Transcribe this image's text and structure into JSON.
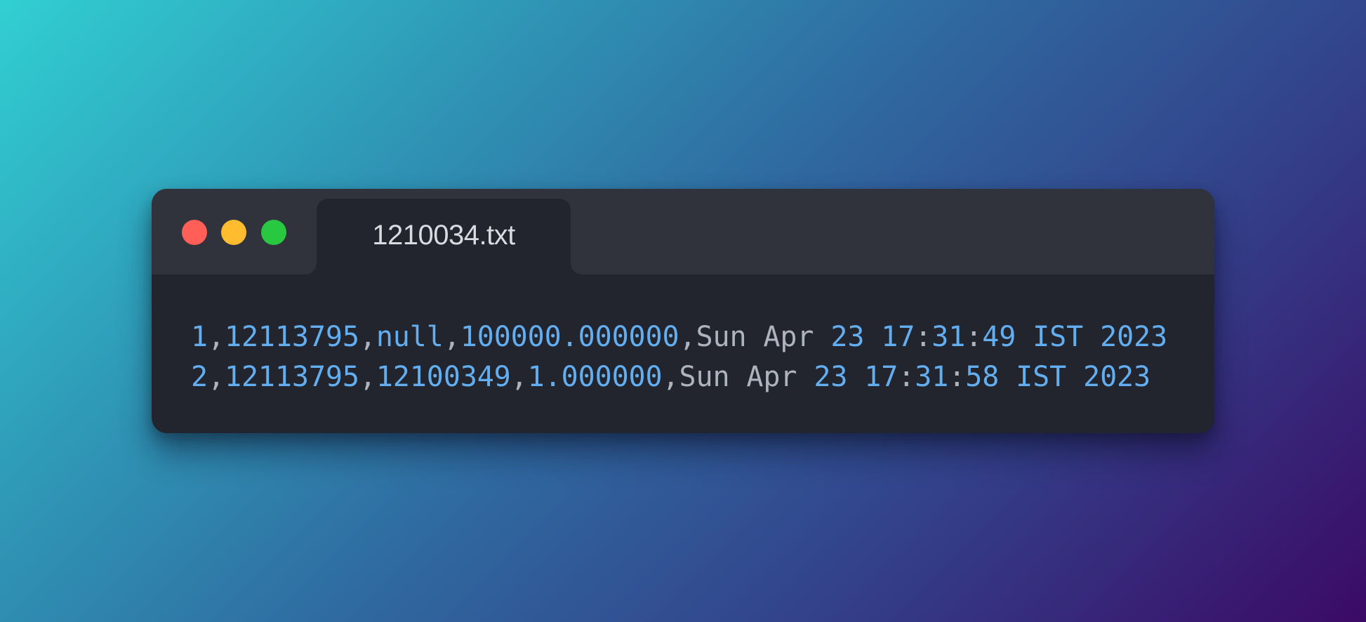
{
  "window": {
    "tab_title": "1210034.txt",
    "traffic_lights": [
      {
        "name": "close",
        "color": "#ff5f57"
      },
      {
        "name": "minimize",
        "color": "#febc2e"
      },
      {
        "name": "zoom",
        "color": "#28c840"
      }
    ]
  },
  "file": {
    "lines": [
      {
        "tokens": [
          {
            "text": "1",
            "kind": "number"
          },
          {
            "text": ",",
            "kind": "text"
          },
          {
            "text": "12113795",
            "kind": "number"
          },
          {
            "text": ",",
            "kind": "text"
          },
          {
            "text": "null",
            "kind": "number"
          },
          {
            "text": ",",
            "kind": "text"
          },
          {
            "text": "100000.000000",
            "kind": "number"
          },
          {
            "text": ",Sun Apr ",
            "kind": "text"
          },
          {
            "text": "23 17",
            "kind": "number"
          },
          {
            "text": ":",
            "kind": "text"
          },
          {
            "text": "31",
            "kind": "number"
          },
          {
            "text": ":",
            "kind": "text"
          },
          {
            "text": "49 IST 2023",
            "kind": "number"
          }
        ]
      },
      {
        "tokens": [
          {
            "text": "2",
            "kind": "number"
          },
          {
            "text": ",",
            "kind": "text"
          },
          {
            "text": "12113795",
            "kind": "number"
          },
          {
            "text": ",",
            "kind": "text"
          },
          {
            "text": "12100349",
            "kind": "number"
          },
          {
            "text": ",",
            "kind": "text"
          },
          {
            "text": "1.000000",
            "kind": "number"
          },
          {
            "text": ",Sun Apr ",
            "kind": "text"
          },
          {
            "text": "23 17",
            "kind": "number"
          },
          {
            "text": ":",
            "kind": "text"
          },
          {
            "text": "31",
            "kind": "number"
          },
          {
            "text": ":",
            "kind": "text"
          },
          {
            "text": "58 IST 2023",
            "kind": "number"
          }
        ]
      }
    ]
  },
  "theme": {
    "number_color": "#62aef0",
    "text_color": "#aeb4bf",
    "window_bg": "#22252d",
    "titlebar_bg": "#30333c"
  }
}
